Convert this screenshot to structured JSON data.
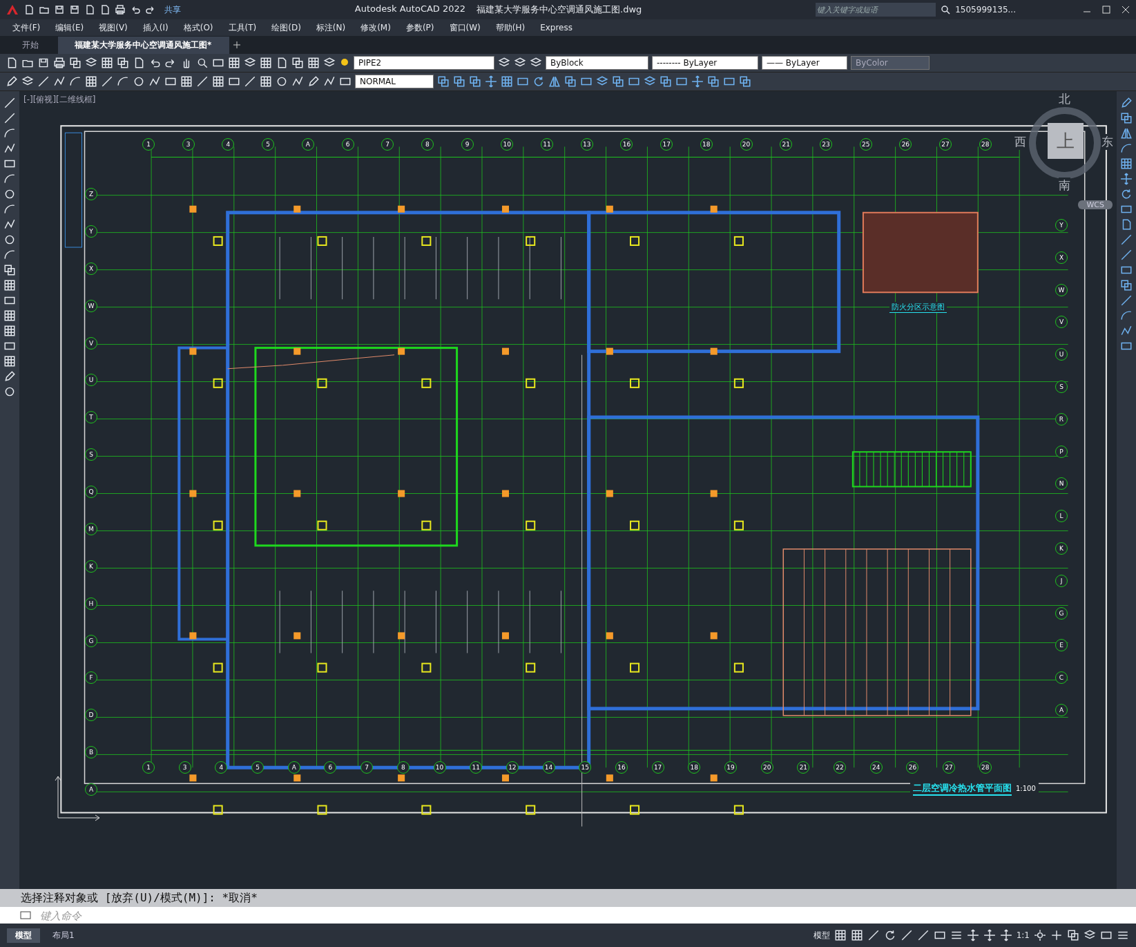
{
  "title_bar": {
    "share": "共享",
    "app_title": "Autodesk AutoCAD 2022",
    "file_name": "福建某大学服务中心空调通风施工图.dwg",
    "search": {
      "placeholder": "键入关键字或短语"
    },
    "user": "1505999135..."
  },
  "menu": [
    "文件(F)",
    "编辑(E)",
    "视图(V)",
    "插入(I)",
    "格式(O)",
    "工具(T)",
    "绘图(D)",
    "标注(N)",
    "修改(M)",
    "参数(P)",
    "窗口(W)",
    "帮助(H)",
    "Express"
  ],
  "doc_tabs": [
    {
      "label": "开始",
      "selected": false
    },
    {
      "label": "福建某大学服务中心空调通风施工图*",
      "selected": true
    }
  ],
  "properties": {
    "layer": "PIPE2",
    "object_color": "ByBlock",
    "linetype": "-------- ByLayer",
    "lineweight": "—— ByLayer",
    "plot_style": "ByColor",
    "text_style": "NORMAL"
  },
  "viewport": {
    "label": "[-][俯视][二维线框]",
    "viewcube": {
      "north": "北",
      "south": "南",
      "east": "东",
      "west": "西",
      "face": "上",
      "ucs": "WCS"
    }
  },
  "drawing": {
    "top_axes": [
      "1",
      "3",
      "4",
      "5",
      "A",
      "6",
      "7",
      "8",
      "9",
      "10",
      "11",
      "13",
      "16",
      "17",
      "18",
      "20",
      "21",
      "23",
      "25",
      "26",
      "27",
      "28"
    ],
    "bottom_axes": [
      "1",
      "3",
      "4",
      "5",
      "A",
      "6",
      "7",
      "8",
      "10",
      "11",
      "12",
      "14",
      "15",
      "16",
      "17",
      "18",
      "19",
      "20",
      "21",
      "22",
      "24",
      "26",
      "27",
      "28"
    ],
    "left_axes": [
      "Z",
      "Y",
      "X",
      "W",
      "V",
      "U",
      "T",
      "S",
      "Q",
      "M",
      "K",
      "H",
      "G",
      "F",
      "D",
      "B",
      "A"
    ],
    "right_axes": [
      "Y",
      "X",
      "W",
      "V",
      "U",
      "S",
      "R",
      "P",
      "N",
      "L",
      "K",
      "J",
      "G",
      "E",
      "C",
      "A"
    ],
    "inset_title": "防火分区示意图",
    "plan_title": "二层空调冷热水管平面图",
    "plan_scale": "1:100"
  },
  "command": {
    "history": "选择注释对象或 [放弃(U)/模式(M)]: *取消*",
    "placeholder": "键入命令"
  },
  "layout_tabs": [
    {
      "label": "模型",
      "selected": true
    },
    {
      "label": "布局1",
      "selected": false
    }
  ],
  "status_bar": {
    "space": "模型",
    "scale": "1:1"
  }
}
